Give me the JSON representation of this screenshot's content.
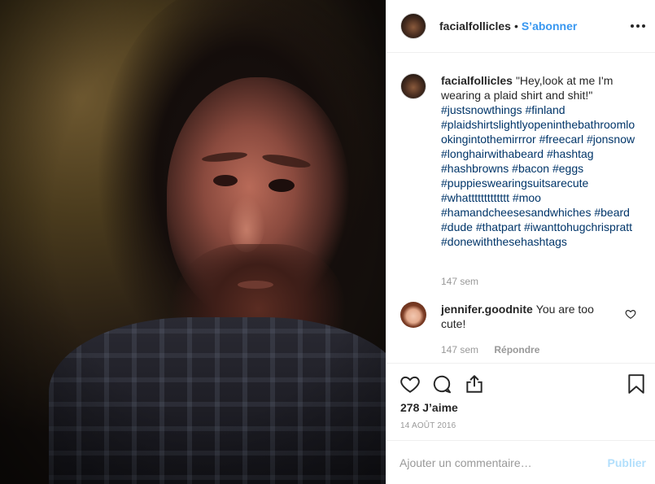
{
  "post": {
    "author": "facialfollicles",
    "separator": "•",
    "follow_label": "S’abonner",
    "more_icon": "more-horizontal-icon"
  },
  "caption": {
    "username": "facialfollicles",
    "text": "\"Hey,look at me I'm wearing a plaid shirt and shit!\"",
    "hashtags": "#justsnowthings #finland #plaidshirtslightlyopeninthebathroomlookingintothemirrror #freecarl #jonsnow #longhairwithabeard #hashtag #hashbrowns #bacon #eggs #puppieswearingsuitsarecute #whattttttttttttt #moo #hamandcheesesandwhiches #beard #dude #thatpart #iwanttohugchrispratt #donewiththesehashtags",
    "time": "147 sem"
  },
  "comments": [
    {
      "username": "jennifer.goodnite",
      "text": "You are too cute!",
      "time": "147 sem",
      "reply_label": "Répondre",
      "like_icon": "heart-outline-icon"
    }
  ],
  "actions": {
    "like_icon": "heart-icon",
    "comment_icon": "comment-icon",
    "share_icon": "share-icon",
    "save_icon": "bookmark-icon"
  },
  "likes_text": "278 J’aime",
  "date": "14 AOÛT 2016",
  "add_comment": {
    "placeholder": "Ajouter un commentaire…",
    "publish_label": "Publier"
  },
  "colors": {
    "link": "#3897f0",
    "hashtag": "#003569",
    "muted": "#999999",
    "publish_disabled": "#b2dffc"
  }
}
